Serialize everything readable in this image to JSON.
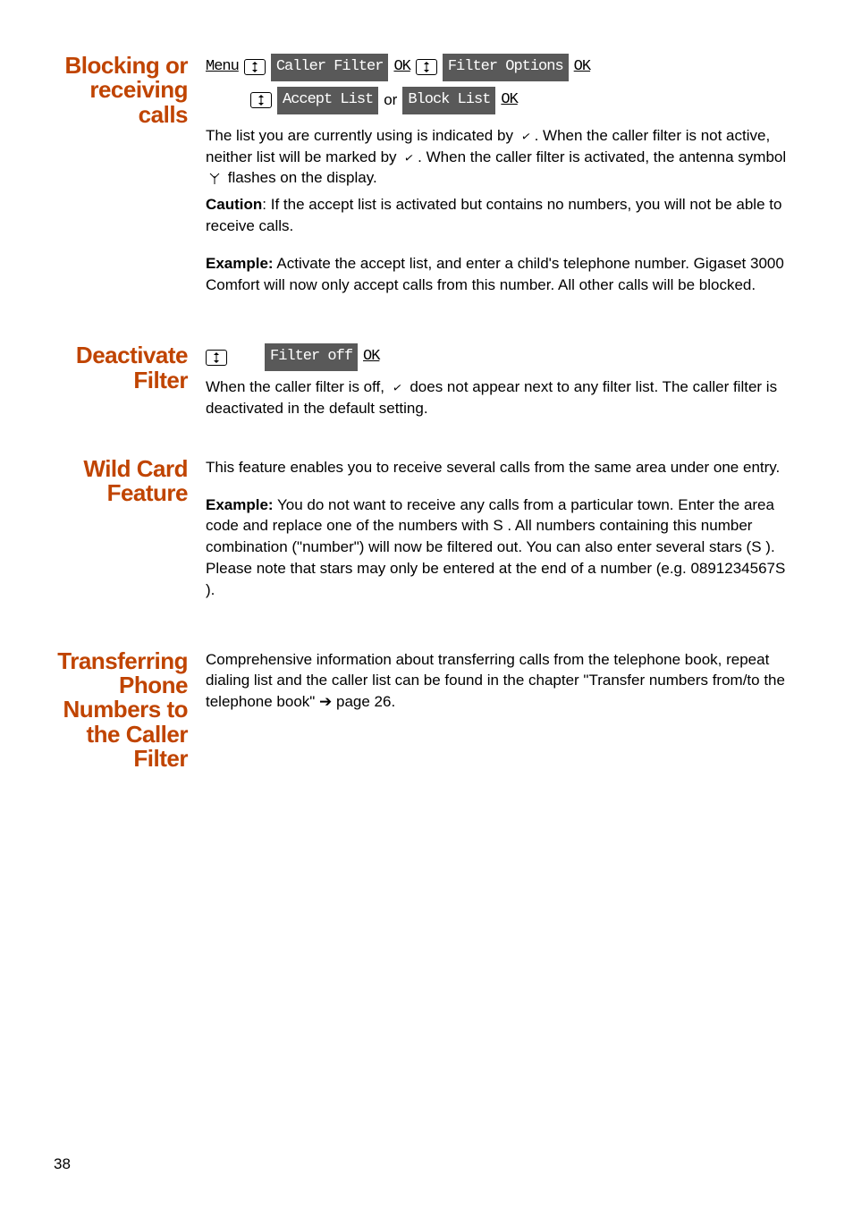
{
  "section1": {
    "heading": "Blocking or receiving calls",
    "line1": {
      "menu": "Menu",
      "seg_caller_filter": "Caller Filter",
      "ok1": "OK",
      "seg_filter_options": "Filter Options",
      "ok2": "OK"
    },
    "line2": {
      "seg_accept_list": "Accept List",
      "plain_or": "or",
      "seg_block_list": "Block List",
      "ok3": "OK"
    },
    "para1_a": "The list you are currently using is indicated by ",
    "para1_b": ". When the caller filter is not active, neither list will be marked by ",
    "para1_c": ". When the caller filter is activated, the antenna symbol ",
    "para1_d": " flashes on the display.",
    "caution_label": "Caution",
    "caution_text": ": If the accept list is activated but contains no numbers, you will not be able to receive calls.",
    "example_label": "Example:",
    "example_text": " Activate the accept list, and enter a child's telephone number. Gigaset 3000 Comfort will now only accept calls from this number. All other calls will be blocked."
  },
  "section2": {
    "heading": "Deactivate Filter",
    "seg_filter_off": "Filter off",
    "ok": "OK",
    "para_a": "When the caller filter is off, ",
    "para_b": " does not appear next to any filter list. The caller filter is deactivated in the default setting."
  },
  "section3": {
    "heading": "Wild Card Feature",
    "intro": "This feature enables you to receive several calls from the same area under one entry.",
    "example_label": "Example:",
    "example_text_a": " You do not want to receive any calls from a particular town. Enter the area code and replace one of the numbers with ",
    "example_text_b": " . All numbers containing this number combination (\"number\") will now be filtered out. You can also enter several stars (",
    "example_text_c": " ). Please note that stars may only be entered at the end of a number (e.g. 0891234567",
    "example_text_d": " )."
  },
  "section4": {
    "heading": "Transferring Phone Numbers to the Caller Filter",
    "para": "Comprehensive information about transferring calls from the telephone book, repeat dialing list and the caller list can be found in the chapter \"Transfer numbers from/to the telephone book\" ➔ page 26."
  },
  "star": "S",
  "page": "38"
}
